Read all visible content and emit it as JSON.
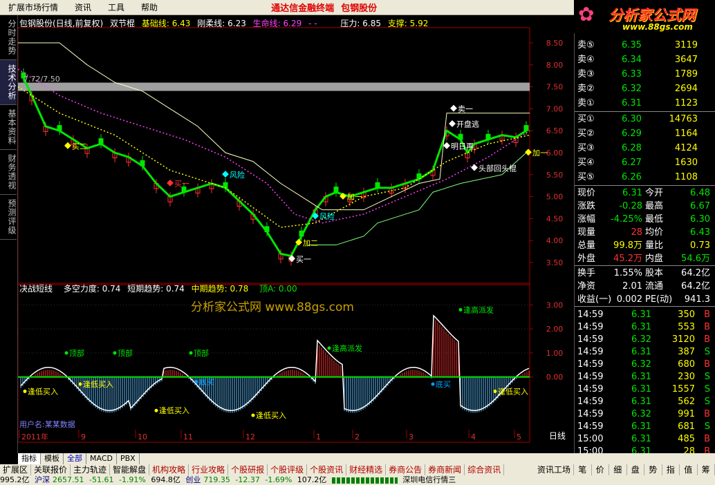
{
  "menu": [
    "扩展市场行情",
    "资讯",
    "工具",
    "帮助"
  ],
  "brand": "通达信金融终端",
  "stock_name": "包钢股份",
  "logo": {
    "main": "分析家公式网",
    "url": "www.88gs.com"
  },
  "side_tabs": [
    "分时走势",
    "技术分析",
    "基本资料",
    "财务透视",
    "预测评级"
  ],
  "main_header": {
    "title": "包钢股份(日线,前复权)",
    "formula": "双节棍",
    "base_label": "基础线: 6.43",
    "soft_label": "刚柔线: 6.23",
    "life_label": "生命线: 6.29",
    "extra": "- -",
    "pressure": "压力: 6.85",
    "support": "支撑: 5.92"
  },
  "price_axis": [
    "8.50",
    "8.00",
    "7.50",
    "7.00",
    "6.50",
    "6.00",
    "5.50",
    "5.00",
    "4.50",
    "4.00",
    "3.50"
  ],
  "osc_axis": [
    "3.00",
    "2.00",
    "1.00",
    "0.00"
  ],
  "sub_header": {
    "name": "决战短线",
    "bull": "多空力度: 0.74",
    "short": "短期趋势: 0.74",
    "mid": "中期趋势: 0.78",
    "top": "顶A: 0.00"
  },
  "watermark": "分析家公式网 www.88gs.com",
  "sample_price": "7.72/7.50",
  "bottom_watermark": "用户名:某某数据",
  "time_axis": [
    "2011年",
    "9",
    "10",
    "11",
    "12",
    "1",
    "2",
    "3",
    "4",
    "5"
  ],
  "period": "日线",
  "chart_labels": {
    "buy1": "买一",
    "buy2": "买二",
    "add": "加一",
    "add2": "加二",
    "sell1": "卖一",
    "risk": "风险",
    "escape": "开盘逃",
    "tomorrow": "明日再",
    "head": "头部回头棍",
    "top": "顶部",
    "low_buy": "逢低买入",
    "high_sell": "逢高派发",
    "dibuy": "底买"
  },
  "asks": [
    {
      "label": "卖⑤",
      "price": "6.35",
      "vol": "3119"
    },
    {
      "label": "卖④",
      "price": "6.34",
      "vol": "3647"
    },
    {
      "label": "卖③",
      "price": "6.33",
      "vol": "1789"
    },
    {
      "label": "卖②",
      "price": "6.32",
      "vol": "2694"
    },
    {
      "label": "卖①",
      "price": "6.31",
      "vol": "1123"
    }
  ],
  "bids": [
    {
      "label": "买①",
      "price": "6.30",
      "vol": "14763"
    },
    {
      "label": "买②",
      "price": "6.29",
      "vol": "1164"
    },
    {
      "label": "买③",
      "price": "6.28",
      "vol": "4124"
    },
    {
      "label": "买④",
      "price": "6.27",
      "vol": "1630"
    },
    {
      "label": "买⑤",
      "price": "6.26",
      "vol": "1108"
    }
  ],
  "quote": [
    {
      "l1": "现价",
      "v1": "6.31",
      "c1": "green",
      "l2": "今开",
      "v2": "6.48",
      "c2": "green"
    },
    {
      "l1": "涨跌",
      "v1": "-0.28",
      "c1": "green",
      "l2": "最高",
      "v2": "6.67",
      "c2": "green"
    },
    {
      "l1": "涨幅",
      "v1": "-4.25%",
      "c1": "green",
      "l2": "最低",
      "v2": "6.30",
      "c2": "green"
    },
    {
      "l1": "现量",
      "v1": "28",
      "c1": "red",
      "l2": "均价",
      "v2": "6.43",
      "c2": "green"
    },
    {
      "l1": "总量",
      "v1": "99.8万",
      "c1": "yel",
      "l2": "量比",
      "v2": "0.73",
      "c2": "yel"
    },
    {
      "l1": "外盘",
      "v1": "45.2万",
      "c1": "red",
      "l2": "内盘",
      "v2": "54.6万",
      "c2": "green"
    }
  ],
  "fund": [
    {
      "l1": "换手",
      "v1": "1.55%",
      "l2": "股本",
      "v2": "64.2亿"
    },
    {
      "l1": "净资",
      "v1": "2.01",
      "l2": "流通",
      "v2": "64.2亿"
    },
    {
      "l1": "收益(一)",
      "v1": "0.002",
      "l2": "PE(动)",
      "v2": "941.3"
    }
  ],
  "ticks": [
    {
      "t": "14:59",
      "p": "6.31",
      "v": "350",
      "d": "B"
    },
    {
      "t": "14:59",
      "p": "6.31",
      "v": "553",
      "d": "B"
    },
    {
      "t": "14:59",
      "p": "6.32",
      "v": "3120",
      "d": "B"
    },
    {
      "t": "14:59",
      "p": "6.31",
      "v": "387",
      "d": "S"
    },
    {
      "t": "14:59",
      "p": "6.32",
      "v": "680",
      "d": "B"
    },
    {
      "t": "14:59",
      "p": "6.31",
      "v": "230",
      "d": "S"
    },
    {
      "t": "14:59",
      "p": "6.31",
      "v": "1557",
      "d": "S"
    },
    {
      "t": "14:59",
      "p": "6.31",
      "v": "562",
      "d": "S"
    },
    {
      "t": "14:59",
      "p": "6.32",
      "v": "991",
      "d": "B"
    },
    {
      "t": "14:59",
      "p": "6.31",
      "v": "681",
      "d": "S"
    },
    {
      "t": "15:00",
      "p": "6.31",
      "v": "485",
      "d": "B"
    },
    {
      "t": "15:00",
      "p": "6.31",
      "v": "28",
      "d": "B"
    }
  ],
  "bottom_tabs": [
    "指标",
    "模板",
    "全部",
    "MACD",
    "PBX"
  ],
  "func_tabs": [
    "扩展区",
    "关联报价",
    "主力轨迹",
    "智能解盘",
    "机构攻略",
    "行业攻略",
    "个股研报",
    "个股评级",
    "个股资讯",
    "财经精选",
    "券商公告",
    "券商新闻",
    "综合资讯"
  ],
  "info_tab": "资讯工场",
  "right_tabs": [
    "笔",
    "价",
    "细",
    "盘",
    "势",
    "指",
    "值",
    "筹"
  ],
  "status": {
    "a": "995.2亿",
    "sh_label": "沪深",
    "sh_val": "2657.51",
    "sh_chg": "-51.61",
    "sh_pct": "-1.91%",
    "sh_amt": "694.8亿",
    "cy_label": "创业",
    "cy_val": "719.35",
    "cy_chg": "-12.37",
    "cy_pct": "-1.69%",
    "cy_amt": "107.2亿",
    "feed": "深圳电信行情三"
  },
  "colors": {
    "up": "#ff3232",
    "down": "#00e600",
    "accent": "#ffff00",
    "bg": "#000000"
  }
}
